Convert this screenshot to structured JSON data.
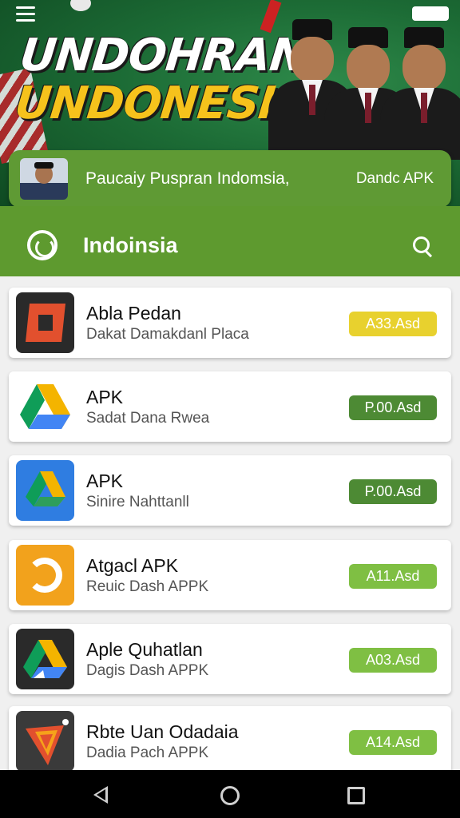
{
  "hero": {
    "title_line1": "UNDOHRAN",
    "title_line2": "UNDONESIA!"
  },
  "promo": {
    "text": "Paucaiy Puspran Indomsia,",
    "action": "Dandc APK"
  },
  "header": {
    "title": "Indoinsia"
  },
  "apps": [
    {
      "name": "Abla Pedan",
      "subtitle": "Dakat Damakdanl Placa",
      "badge": "A33.Asd",
      "badge_color": "#e8d12e",
      "icon": "red-box-icon"
    },
    {
      "name": "APK",
      "subtitle": "Sadat Dana Rwea",
      "badge": "P.00.Asd",
      "badge_color": "#4d8a34",
      "icon": "drive-triangle-icon"
    },
    {
      "name": "APK",
      "subtitle": "Sinire Nahttanll",
      "badge": "P.00.Asd",
      "badge_color": "#4d8a34",
      "icon": "drive-triangle-blue-icon"
    },
    {
      "name": "Atgacl APK",
      "subtitle": "Reuic Dash APPK",
      "badge": "A11.Asd",
      "badge_color": "#7fbf43",
      "icon": "sync-arrows-icon"
    },
    {
      "name": "Aple Quhatlan",
      "subtitle": "Dagis Dash APPK",
      "badge": "A03.Asd",
      "badge_color": "#7fbf43",
      "icon": "drive-triangle-dark-icon"
    },
    {
      "name": "Rbte Uan Odadaia",
      "subtitle": "Dadia Pach APPK",
      "badge": "A14.Asd",
      "badge_color": "#7fbf43",
      "icon": "shield-icon"
    }
  ],
  "colors": {
    "header_green": "#5e9a2f",
    "promo_green": "#5f9a34",
    "title_yellow": "#f6c21c"
  }
}
